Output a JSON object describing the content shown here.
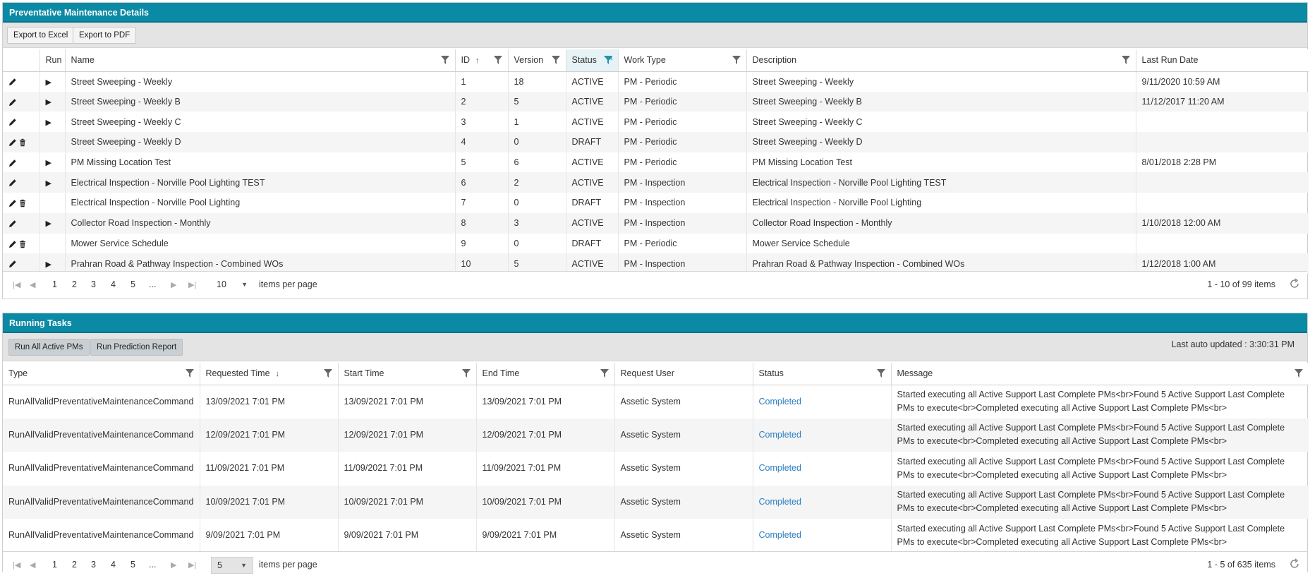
{
  "pm": {
    "title": "Preventative Maintenance Details",
    "export_excel": "Export to Excel",
    "export_pdf": "Export to PDF",
    "columns": [
      "",
      "Run",
      "Name",
      "ID",
      "Version",
      "Status",
      "Work Type",
      "Description",
      "Last Run Date"
    ],
    "rows": [
      {
        "name": "Street Sweeping - Weekly",
        "id": "1",
        "version": "18",
        "status": "ACTIVE",
        "work_type": "PM - Periodic",
        "description": "Street Sweeping - Weekly",
        "last_run": "9/11/2020 10:59 AM",
        "run": true,
        "delete": false
      },
      {
        "name": "Street Sweeping - Weekly B",
        "id": "2",
        "version": "5",
        "status": "ACTIVE",
        "work_type": "PM - Periodic",
        "description": "Street Sweeping - Weekly B",
        "last_run": "11/12/2017 11:20 AM",
        "run": true,
        "delete": false
      },
      {
        "name": "Street Sweeping - Weekly C",
        "id": "3",
        "version": "1",
        "status": "ACTIVE",
        "work_type": "PM - Periodic",
        "description": "Street Sweeping - Weekly C",
        "last_run": "",
        "run": true,
        "delete": false
      },
      {
        "name": "Street Sweeping - Weekly D",
        "id": "4",
        "version": "0",
        "status": "DRAFT",
        "work_type": "PM - Periodic",
        "description": "Street Sweeping - Weekly D",
        "last_run": "",
        "run": false,
        "delete": true
      },
      {
        "name": "PM Missing Location Test",
        "id": "5",
        "version": "6",
        "status": "ACTIVE",
        "work_type": "PM - Periodic",
        "description": "PM Missing Location Test",
        "last_run": "8/01/2018 2:28 PM",
        "run": true,
        "delete": false
      },
      {
        "name": "Electrical Inspection - Norville Pool Lighting TEST",
        "id": "6",
        "version": "2",
        "status": "ACTIVE",
        "work_type": "PM - Inspection",
        "description": "Electrical Inspection - Norville Pool Lighting TEST",
        "last_run": "",
        "run": true,
        "delete": false
      },
      {
        "name": "Electrical Inspection - Norville Pool Lighting",
        "id": "7",
        "version": "0",
        "status": "DRAFT",
        "work_type": "PM - Inspection",
        "description": "Electrical Inspection - Norville Pool Lighting",
        "last_run": "",
        "run": false,
        "delete": true
      },
      {
        "name": "Collector Road Inspection - Monthly",
        "id": "8",
        "version": "3",
        "status": "ACTIVE",
        "work_type": "PM - Inspection",
        "description": "Collector Road Inspection - Monthly",
        "last_run": "1/10/2018 12:00 AM",
        "run": true,
        "delete": false
      },
      {
        "name": "Mower Service Schedule",
        "id": "9",
        "version": "0",
        "status": "DRAFT",
        "work_type": "PM - Periodic",
        "description": "Mower Service Schedule",
        "last_run": "",
        "run": false,
        "delete": true
      },
      {
        "name": "Prahran Road & Pathway Inspection - Combined WOs",
        "id": "10",
        "version": "5",
        "status": "ACTIVE",
        "work_type": "PM - Inspection",
        "description": "Prahran Road & Pathway Inspection - Combined WOs",
        "last_run": "1/12/2018 1:00 AM",
        "run": true,
        "delete": false
      }
    ],
    "pager": {
      "pages": [
        "1",
        "2",
        "3",
        "4",
        "5",
        "..."
      ],
      "page_size": "10",
      "items_per_page": "items per page",
      "count": "1 - 10 of 99 items"
    }
  },
  "rt": {
    "title": "Running Tasks",
    "run_all": "Run All Active PMs",
    "run_prediction": "Run Prediction Report",
    "last_updated": "Last auto updated : 3:30:31 PM",
    "columns": [
      "Type",
      "Requested Time",
      "Start Time",
      "End Time",
      "Request User",
      "Status",
      "Message"
    ],
    "rows": [
      {
        "type": "RunAllValidPreventativeMaintenanceCommand",
        "requested": "13/09/2021 7:01 PM",
        "start": "13/09/2021 7:01 PM",
        "end": "13/09/2021 7:01 PM",
        "user": "Assetic System",
        "status": "Completed",
        "message": "Started executing all Active Support Last Complete PMs<br>Found 5 Active Support Last Complete PMs to execute<br>Completed executing all Active Support Last Complete PMs<br>"
      },
      {
        "type": "RunAllValidPreventativeMaintenanceCommand",
        "requested": "12/09/2021 7:01 PM",
        "start": "12/09/2021 7:01 PM",
        "end": "12/09/2021 7:01 PM",
        "user": "Assetic System",
        "status": "Completed",
        "message": "Started executing all Active Support Last Complete PMs<br>Found 5 Active Support Last Complete PMs to execute<br>Completed executing all Active Support Last Complete PMs<br>"
      },
      {
        "type": "RunAllValidPreventativeMaintenanceCommand",
        "requested": "11/09/2021 7:01 PM",
        "start": "11/09/2021 7:01 PM",
        "end": "11/09/2021 7:01 PM",
        "user": "Assetic System",
        "status": "Completed",
        "message": "Started executing all Active Support Last Complete PMs<br>Found 5 Active Support Last Complete PMs to execute<br>Completed executing all Active Support Last Complete PMs<br>"
      },
      {
        "type": "RunAllValidPreventativeMaintenanceCommand",
        "requested": "10/09/2021 7:01 PM",
        "start": "10/09/2021 7:01 PM",
        "end": "10/09/2021 7:01 PM",
        "user": "Assetic System",
        "status": "Completed",
        "message": "Started executing all Active Support Last Complete PMs<br>Found 5 Active Support Last Complete PMs to execute<br>Completed executing all Active Support Last Complete PMs<br>"
      },
      {
        "type": "RunAllValidPreventativeMaintenanceCommand",
        "requested": "9/09/2021 7:01 PM",
        "start": "9/09/2021 7:01 PM",
        "end": "9/09/2021 7:01 PM",
        "user": "Assetic System",
        "status": "Completed",
        "message": "Started executing all Active Support Last Complete PMs<br>Found 5 Active Support Last Complete PMs to execute<br>Completed executing all Active Support Last Complete PMs<br>"
      }
    ],
    "pager": {
      "pages": [
        "1",
        "2",
        "3",
        "4",
        "5",
        "..."
      ],
      "page_size": "5",
      "items_per_page": "items per page",
      "count": "1 - 5 of 635 items"
    }
  },
  "colors": {
    "header": "#0b8aa6",
    "link": "#2a7ec2"
  }
}
